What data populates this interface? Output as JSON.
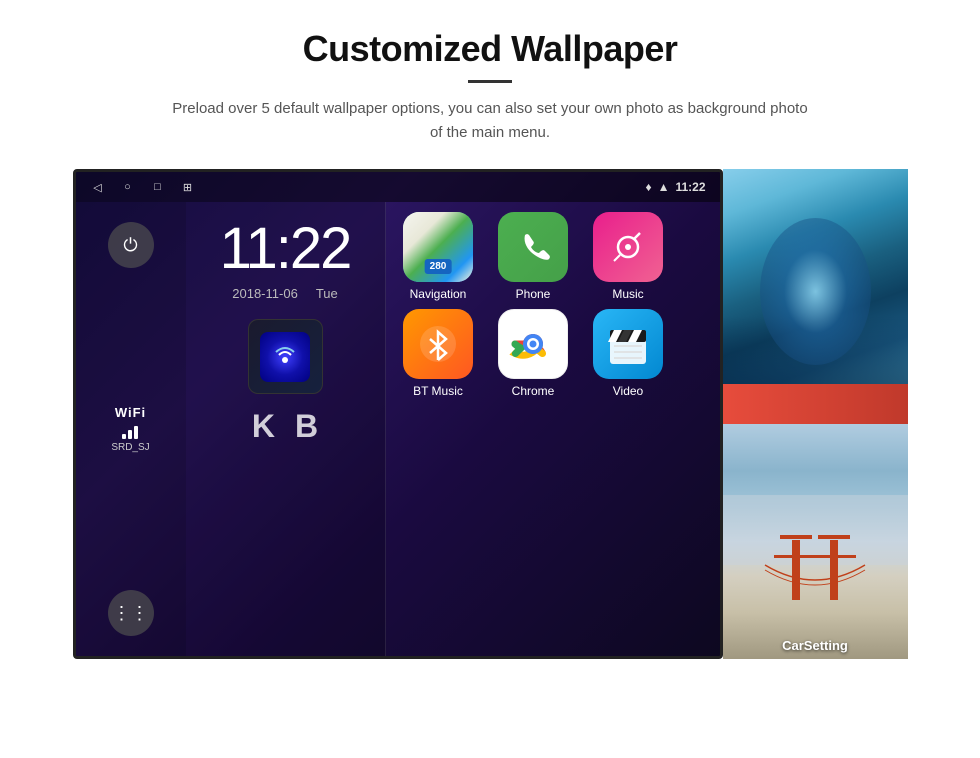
{
  "header": {
    "title": "Customized Wallpaper",
    "description": "Preload over 5 default wallpaper options, you can also set your own photo as background photo of the main menu."
  },
  "statusBar": {
    "time": "11:22",
    "navButtons": [
      "◁",
      "○",
      "□",
      "⊞"
    ],
    "icons": [
      "location",
      "wifi"
    ]
  },
  "clock": {
    "time": "11:22",
    "date": "2018-11-06",
    "day": "Tue"
  },
  "wifi": {
    "label": "WiFi",
    "ssid": "SRD_SJ"
  },
  "apps": [
    {
      "name": "Navigation",
      "icon": "navigation"
    },
    {
      "name": "Phone",
      "icon": "phone"
    },
    {
      "name": "Music",
      "icon": "music"
    },
    {
      "name": "BT Music",
      "icon": "btmusic"
    },
    {
      "name": "Chrome",
      "icon": "chrome"
    },
    {
      "name": "Video",
      "icon": "video"
    }
  ],
  "wallpapers": [
    {
      "label": "",
      "type": "ice"
    },
    {
      "label": "CarSetting",
      "type": "bridge"
    }
  ]
}
